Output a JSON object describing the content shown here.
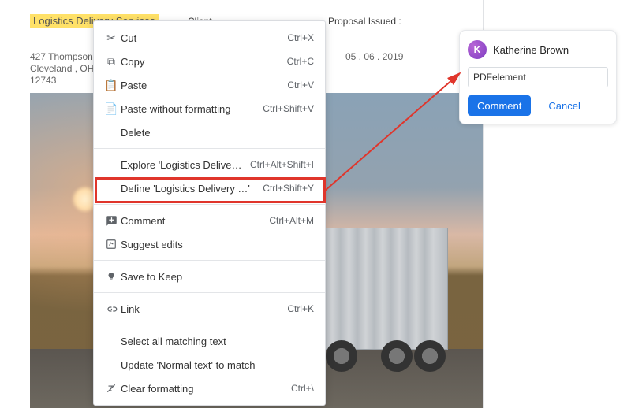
{
  "doc": {
    "highlighted_text": "Logistics Delivery Services",
    "client_label": "Client",
    "proposal_label": "Proposal Issued :",
    "address": {
      "line1": "427 Thompson",
      "line2": "Cleveland , OH",
      "line3": "12743"
    },
    "date": "05 . 06 . 2019"
  },
  "context_menu": {
    "cut": {
      "label": "Cut",
      "shortcut": "Ctrl+X"
    },
    "copy": {
      "label": "Copy",
      "shortcut": "Ctrl+C"
    },
    "paste": {
      "label": "Paste",
      "shortcut": "Ctrl+V"
    },
    "paste_no_fmt": {
      "label": "Paste without formatting",
      "shortcut": "Ctrl+Shift+V"
    },
    "delete": {
      "label": "Delete",
      "shortcut": ""
    },
    "explore": {
      "label": "Explore 'Logistics Delivery …'",
      "shortcut": "Ctrl+Alt+Shift+I"
    },
    "define": {
      "label": "Define 'Logistics Delivery …'",
      "shortcut": "Ctrl+Shift+Y"
    },
    "comment": {
      "label": "Comment",
      "shortcut": "Ctrl+Alt+M"
    },
    "suggest": {
      "label": "Suggest edits",
      "shortcut": ""
    },
    "keep": {
      "label": "Save to Keep",
      "shortcut": ""
    },
    "link": {
      "label": "Link",
      "shortcut": "Ctrl+K"
    },
    "select_match": {
      "label": "Select all matching text",
      "shortcut": ""
    },
    "update_normal": {
      "label": "Update 'Normal text' to match",
      "shortcut": ""
    },
    "clear_fmt": {
      "label": "Clear formatting",
      "shortcut": "Ctrl+\\"
    }
  },
  "comment_box": {
    "avatar_initial": "K",
    "author": "Katherine Brown",
    "input_value": "PDFelement",
    "submit_label": "Comment",
    "cancel_label": "Cancel"
  },
  "colors": {
    "accent": "#1a73e8",
    "highlight_border": "#e0352b",
    "text_highlight": "#ffe168"
  }
}
